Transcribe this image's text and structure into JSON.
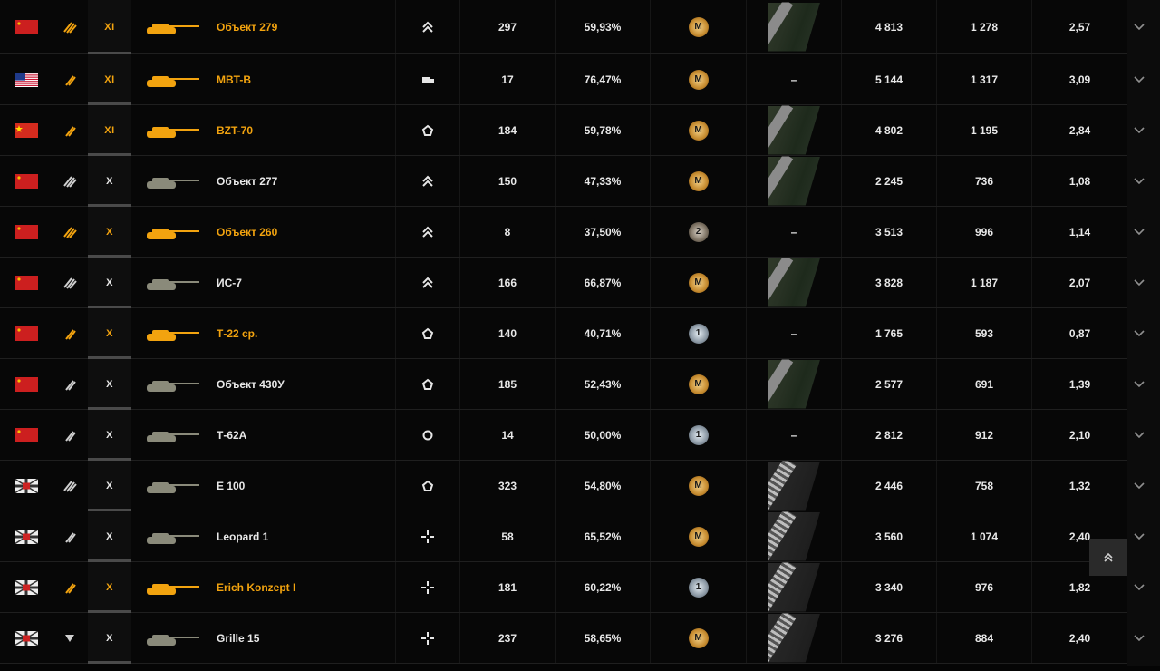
{
  "colors": {
    "gold": "#f2a30f",
    "white": "#e8e8e8",
    "background": "#050505"
  },
  "rows": [
    {
      "nation": "ussr",
      "tank_class": "heavy-tank",
      "tier": "XI",
      "name": "Объект 279",
      "premium_color": "gold",
      "role": "heavy-assault",
      "battles": "297",
      "win_rate": "59,93%",
      "mastery": "M",
      "mastery_kind": "m",
      "marks": "ussr-2-marks-gun",
      "avg_damage": "4 813",
      "avg_xp": "1 278",
      "kd": "2,57"
    },
    {
      "nation": "usa",
      "tank_class": "medium-tank",
      "tier": "XI",
      "name": "MBT-B",
      "premium_color": "gold",
      "role": "medium-versatile",
      "battles": "17",
      "win_rate": "76,47%",
      "mastery": "M",
      "mastery_kind": "m",
      "marks": "–",
      "avg_damage": "5 144",
      "avg_xp": "1 317",
      "kd": "3,09"
    },
    {
      "nation": "china",
      "tank_class": "medium-tank",
      "tier": "XI",
      "name": "BZT-70",
      "premium_color": "gold",
      "role": "support",
      "battles": "184",
      "win_rate": "59,78%",
      "mastery": "M",
      "mastery_kind": "m",
      "marks": "china-3-marks",
      "avg_damage": "4 802",
      "avg_xp": "1 195",
      "kd": "2,84"
    },
    {
      "nation": "ussr",
      "tank_class": "heavy-tank",
      "tier": "X",
      "name": "Объект 277",
      "premium_color": "white",
      "role": "heavy-assault",
      "battles": "150",
      "win_rate": "47,33%",
      "mastery": "M",
      "mastery_kind": "m",
      "marks": "ussr-2-marks",
      "avg_damage": "2 245",
      "avg_xp": "736",
      "kd": "1,08"
    },
    {
      "nation": "ussr",
      "tank_class": "heavy-tank",
      "tier": "X",
      "name": "Объект 260",
      "premium_color": "gold",
      "role": "heavy-assault",
      "battles": "8",
      "win_rate": "37,50%",
      "mastery": "2",
      "mastery_kind": "r2",
      "marks": "–",
      "avg_damage": "3 513",
      "avg_xp": "996",
      "kd": "1,14"
    },
    {
      "nation": "ussr",
      "tank_class": "heavy-tank",
      "tier": "X",
      "name": "ИС-7",
      "premium_color": "white",
      "role": "heavy-assault",
      "battles": "166",
      "win_rate": "66,87%",
      "mastery": "M",
      "mastery_kind": "m",
      "marks": "ussr-2-marks-gun",
      "avg_damage": "3 828",
      "avg_xp": "1 187",
      "kd": "2,07"
    },
    {
      "nation": "ussr",
      "tank_class": "medium-tank",
      "tier": "X",
      "name": "Т-22 ср.",
      "premium_color": "gold",
      "role": "support",
      "battles": "140",
      "win_rate": "40,71%",
      "mastery": "1",
      "mastery_kind": "r1",
      "marks": "–",
      "avg_damage": "1 765",
      "avg_xp": "593",
      "kd": "0,87"
    },
    {
      "nation": "ussr",
      "tank_class": "medium-tank",
      "tier": "X",
      "name": "Объект 430У",
      "premium_color": "white",
      "role": "support",
      "battles": "185",
      "win_rate": "52,43%",
      "mastery": "M",
      "mastery_kind": "m",
      "marks": "ussr-2-marks",
      "avg_damage": "2 577",
      "avg_xp": "691",
      "kd": "1,39"
    },
    {
      "nation": "ussr",
      "tank_class": "medium-tank",
      "tier": "X",
      "name": "Т-62А",
      "premium_color": "white",
      "role": "versatile",
      "battles": "14",
      "win_rate": "50,00%",
      "mastery": "1",
      "mastery_kind": "r1",
      "marks": "–",
      "avg_damage": "2 812",
      "avg_xp": "912",
      "kd": "2,10"
    },
    {
      "nation": "germany",
      "tank_class": "heavy-tank",
      "tier": "X",
      "name": "E 100",
      "premium_color": "white",
      "role": "support",
      "battles": "323",
      "win_rate": "54,80%",
      "mastery": "M",
      "mastery_kind": "m",
      "marks": "germany-3-marks",
      "avg_damage": "2 446",
      "avg_xp": "758",
      "kd": "1,32"
    },
    {
      "nation": "germany",
      "tank_class": "medium-tank",
      "tier": "X",
      "name": "Leopard 1",
      "premium_color": "white",
      "role": "sniper",
      "battles": "58",
      "win_rate": "65,52%",
      "mastery": "M",
      "mastery_kind": "m",
      "marks": "germany-3-marks",
      "avg_damage": "3 560",
      "avg_xp": "1 074",
      "kd": "2,40"
    },
    {
      "nation": "germany",
      "tank_class": "medium-tank",
      "tier": "X",
      "name": "Erich Konzept I",
      "premium_color": "gold",
      "role": "sniper",
      "battles": "181",
      "win_rate": "60,22%",
      "mastery": "1",
      "mastery_kind": "r1",
      "marks": "germany-3-marks",
      "avg_damage": "3 340",
      "avg_xp": "976",
      "kd": "1,82"
    },
    {
      "nation": "germany",
      "tank_class": "spg-td",
      "tier": "X",
      "name": "Grille 15",
      "premium_color": "white",
      "role": "sniper",
      "battles": "237",
      "win_rate": "58,65%",
      "mastery": "M",
      "mastery_kind": "m",
      "marks": "germany-3-marks-gun",
      "avg_damage": "3 276",
      "avg_xp": "884",
      "kd": "2,40"
    }
  ],
  "scroll_top_icon": "double-chevron-up-icon",
  "expand_icon": "chevron-down-icon"
}
